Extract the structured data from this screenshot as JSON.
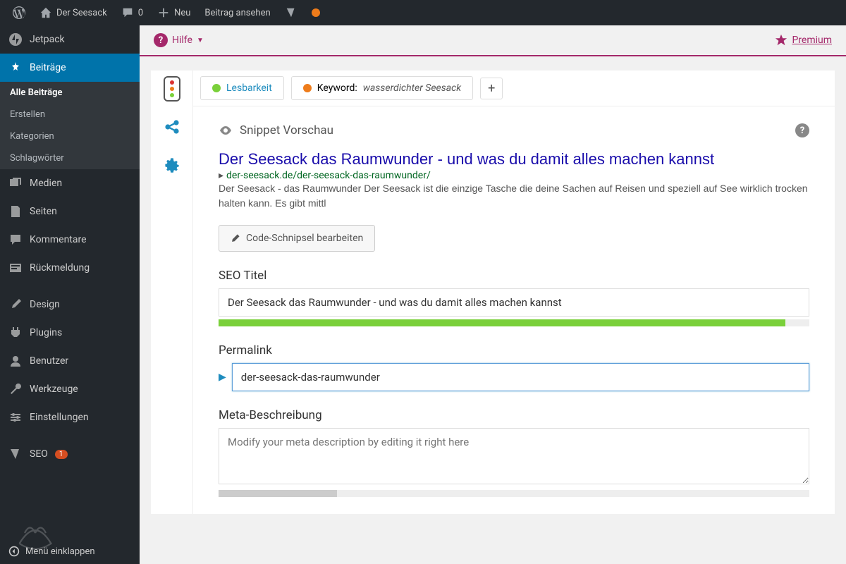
{
  "adminbar": {
    "site_title": "Der Seesack",
    "comments_count": "0",
    "new_label": "Neu",
    "view_post": "Beitrag ansehen"
  },
  "sidebar": {
    "jetpack": "Jetpack",
    "posts": "Beiträge",
    "posts_sub": [
      "Alle Beiträge",
      "Erstellen",
      "Kategorien",
      "Schlagwörter"
    ],
    "media": "Medien",
    "pages": "Seiten",
    "comments": "Kommentare",
    "feedback": "Rückmeldung",
    "design": "Design",
    "plugins": "Plugins",
    "users": "Benutzer",
    "tools": "Werkzeuge",
    "settings": "Einstellungen",
    "seo": "SEO",
    "seo_badge": "1",
    "collapse": "Menü einklappen"
  },
  "topstrip": {
    "help": "Hilfe",
    "premium": "Premium"
  },
  "tabs": {
    "readability": "Lesbarkeit",
    "keyword_prefix": "Keyword:",
    "keyword_value": "wasserdichter Seesack"
  },
  "snippet": {
    "header": "Snippet Vorschau",
    "title": "Der Seesack das Raumwunder - und was du damit alles machen kannst",
    "url": "der-seesack.de/der-seesack-das-raumwunder/",
    "desc": "Der Seesack - das Raumwunder Der Seesack ist die einzige Tasche die deine Sachen auf Reisen und speziell auf See wirklich trocken halten kann. Es gibt mittl",
    "edit_btn": "Code-Schnipsel bearbeiten"
  },
  "fields": {
    "seo_title_label": "SEO Titel",
    "seo_title_value": "Der Seesack das Raumwunder - und was du damit alles machen kannst",
    "permalink_label": "Permalink",
    "permalink_value": "der-seesack-das-raumwunder",
    "meta_label": "Meta-Beschreibung",
    "meta_placeholder": "Modify your meta description by editing it right here"
  }
}
